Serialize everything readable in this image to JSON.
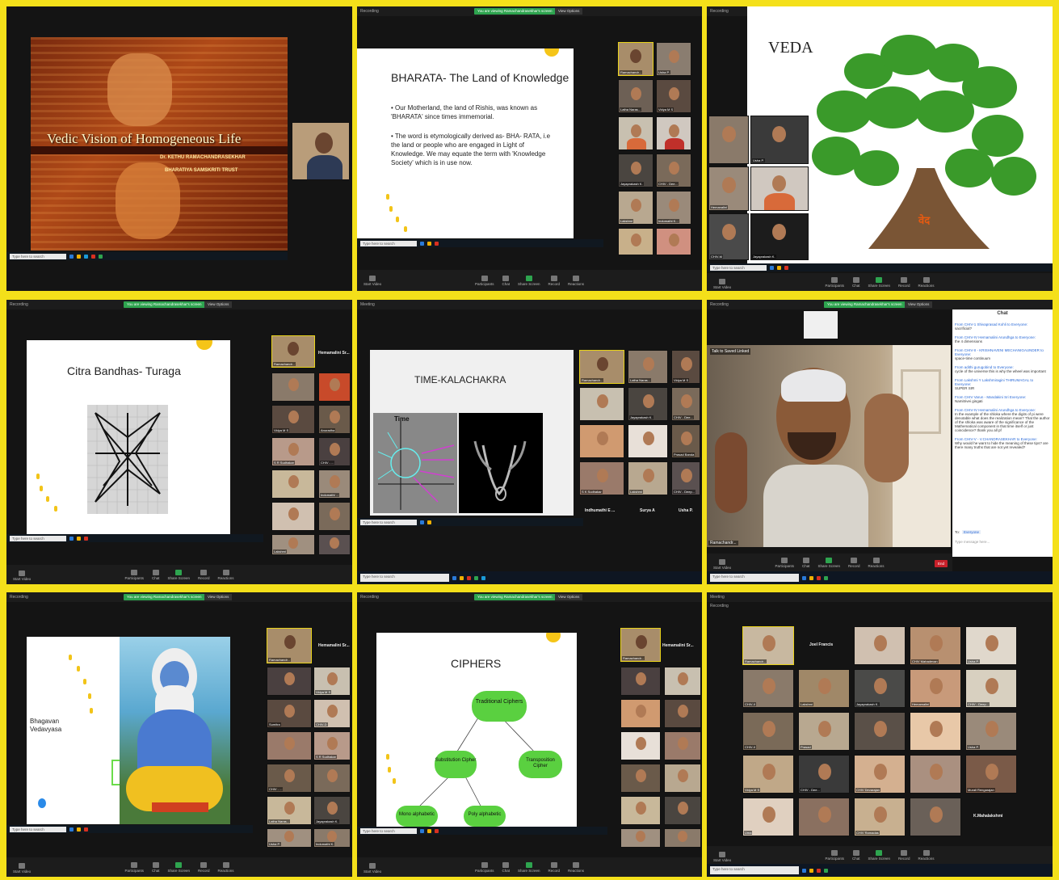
{
  "panel1": {
    "slide_title": "Vedic Vision of Homogeneous Life",
    "presenter": "Dr. KETHU RAMACHANDRASEKHAR",
    "org": "BHARATIYA SAMSKRITI TRUST",
    "search_text": "Type here to search"
  },
  "panel2": {
    "recording": "Recording",
    "banner": "You are viewing Ramachandrasekhar's screen",
    "view_options": "View Options",
    "title": "BHARATA- The Land of Knowledge",
    "bullet1": "Our Motherland, the land of Rishis, was known as 'BHARATA' since times immemorial.",
    "bullet2": "The word is etymologically derived as- BHA- RATA, i.e the land or people who are engaged in Light of Knowledge. We may equate the term with 'Knowledge Society' which is in use now.",
    "search_text": "Type here to search",
    "controls": [
      "Start Video",
      "Participants",
      "Chat",
      "Share Screen",
      "Record",
      "Reactions"
    ],
    "names": [
      "Ramachandr...",
      "Usha P.",
      "Latha Naras...",
      "Vidya M S",
      "",
      "",
      "Jayaprakash K.",
      "CHIV - Dee...",
      "Lakshmi",
      "Indumathi K...",
      "",
      ""
    ]
  },
  "panel3": {
    "recording": "Recording",
    "banner": "You are viewing Ramachandrasekhar's screen",
    "view_options": "View Options",
    "title": "VEDA",
    "veda_root": "वेद",
    "search_text": "Type here to search",
    "controls": [
      "Start Video",
      "Participants",
      "Chat",
      "Share Screen",
      "Record",
      "Reactions"
    ],
    "names": [
      "",
      "Usha P.",
      "Hemanalini",
      "",
      "CHIV-M",
      "Jayaprakash K."
    ]
  },
  "panel4": {
    "recording": "Recording",
    "banner": "You are viewing Ramachandrasekhar's screen",
    "view_options": "View Options",
    "title": "Citra Bandhas- Turaga",
    "side_name": "Hemamalini Sr...",
    "search_text": "Type here to search",
    "controls": [
      "Start Video",
      "Participants",
      "Chat",
      "Share Screen",
      "Record",
      "Reactions"
    ],
    "names": [
      "Ramachandr...",
      "",
      "Vidya M S",
      "Anuradha",
      "S R Sudhakar",
      "CHIV - ...",
      "",
      "Indumathi ...",
      "",
      "",
      "Lakshmi",
      "",
      "Jayaprakash",
      ""
    ]
  },
  "panel5": {
    "meeting": "Meeting",
    "title": "TIME-KALACHAKRA",
    "time_label": "Time",
    "names_bottom": [
      "Indhumathi E ...",
      "Surya A",
      "Usha P."
    ],
    "search_text": "Type here to search",
    "names": [
      "Ramachandr...",
      "Latha Naras...",
      "Vidya M S",
      "",
      "Jayaprakash K.",
      "CHIV - Dee...",
      "",
      "",
      "Prasad Banda",
      "S K Sudhakar",
      "Lakshmi",
      "CHIV - Deep..."
    ]
  },
  "panel6": {
    "recording": "Recording",
    "banner": "You are viewing Ramachandrasekhar's screen",
    "view_options": "View Options",
    "speaker_label": "Talk to Saved Linked",
    "chat_title": "Chat",
    "chat": [
      {
        "from": "From CHIV-1 Shivaprasad Kohli to Everyone:",
        "msg": "sacrificial?"
      },
      {
        "from": "From CHIV-IV Hemamalini Arundhga to Everyone:",
        "msg": "the 4 dimensions"
      },
      {
        "from": "From CHIV-II - KRISHNAVENI MECHANIGAUNDER to Everyone:",
        "msg": "space-time continuum"
      },
      {
        "from": "From adithi gurugobind to Everyone:",
        "msg": "cycle of the universe this is why the wheel was important"
      },
      {
        "from": "From Lakshmi Y Lakshmiragini THIRUMAGAL to Everyone:",
        "msg": "SUPER SIR"
      },
      {
        "from": "From CHIV Varun - Mandakini Sri Everyone:",
        "msg": "Namitrivei gingati"
      },
      {
        "from": "From CHIV-IV Hemamalini Arundhga to Everyone:",
        "msg": "In the example of the shloka where the digits of pi were denotable what does the realization mean? That the author of the shloka was aware of the significance of the Mathematical component in that time itself or just coincidence? thank you all pf"
      },
      {
        "from": "From CHIV-V - V.CHANDRASEKHAR to Everyone:",
        "msg": "Why would he want to hide the meaning of these tips? are there many truths that are not yet revealed?"
      }
    ],
    "to_label": "To:",
    "to_value": "Everyone",
    "chat_placeholder": "Type message here...",
    "end_label": "End",
    "search_text": "Type here to search",
    "controls": [
      "Start Video",
      "Participants",
      "Chat",
      "Share Screen",
      "Record",
      "Reactions"
    ],
    "speaker_name": "Ramachandr..."
  },
  "panel7": {
    "recording": "Recording",
    "banner": "You are viewing Ramachandrasekhar's screen",
    "view_options": "View Options",
    "slide_text": "Bhagavan Vedavyasa",
    "side_name": "Hemamalini Sr...",
    "search_text": "Type here to search",
    "controls": [
      "Start Video",
      "Participants",
      "Chat",
      "Share Screen",
      "Record",
      "Reactions"
    ],
    "names": [
      "Ramachandr...",
      "",
      "Vidya M S",
      "Sumitra",
      "CHIV-D",
      "",
      "S R Sudhakar",
      "CHIV - ...",
      "Latha Naras...",
      "Jayaprakash K.",
      "Usha P.",
      "Indumathi K."
    ]
  },
  "panel8": {
    "recording": "Recording",
    "banner": "You are viewing Ramachandrasekhar's screen",
    "view_options": "View Options",
    "title": "CIPHERS",
    "node_root": "Traditional Ciphers",
    "node_left": "Substitution Cipher",
    "node_right": "Transposition Cipher",
    "node_ll": "Mono alphabetic",
    "node_lr": "Poly alphabetic",
    "side_name": "Hemamalini Sr...",
    "search_text": "Type here to search",
    "controls": [
      "Start Video",
      "Participants",
      "Chat",
      "Share Screen",
      "Record",
      "Reactions"
    ],
    "names": [
      "Ramachandr...",
      "",
      "",
      "",
      "",
      "",
      "",
      "",
      "",
      "",
      "",
      ""
    ]
  },
  "panel9": {
    "meeting": "Meeting",
    "recording": "Recording",
    "joel": "Joel Francis",
    "mahalakshmi": "K.Mahalakshmi",
    "search_text": "Type here to search",
    "controls": [
      "Start Video",
      "Participants",
      "Chat",
      "Share Screen",
      "Record",
      "Reactions"
    ],
    "names": [
      "Ramachandr...",
      "",
      "CHIV Mahadevan",
      "Usha P.",
      "CHIV-II",
      "Lakshmi",
      "Jayaprakash K.",
      "Hemamalini",
      "CHIV - Deep...",
      "CHIV-II",
      "Prasad",
      "",
      "",
      "Usha P.",
      "Vidya M S",
      "CHIV - Dee...",
      "CHIV Devarajan",
      "",
      "Murali Rengarajan",
      "Uma",
      "",
      "CHIV Ramadas",
      "",
      "Anuradha",
      "CHIV - Deep...",
      "CHIV Srinivasan",
      "",
      "CHIV-II Sivakumar",
      "",
      "",
      "CHIV Hemamalini",
      "CHIV - NEELAM...",
      "CHIV Arjun",
      "CHIV KOUSALYA..."
    ]
  },
  "colors": {
    "frame": "#f4e01a",
    "zoom_green": "#2ea44f",
    "end_red": "#c8202a",
    "tree_green": "#3a9a2a"
  }
}
